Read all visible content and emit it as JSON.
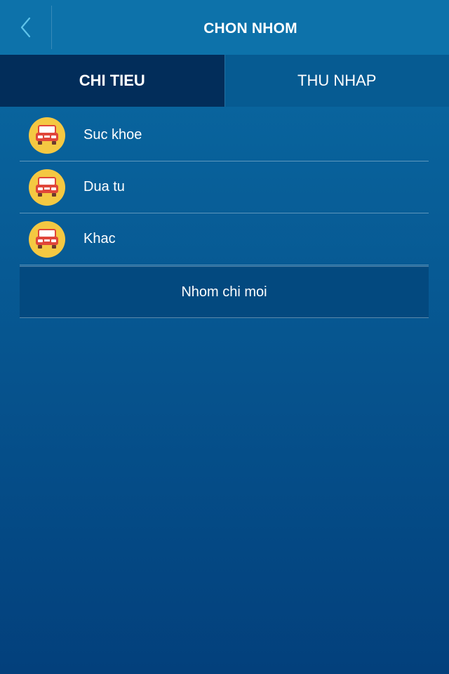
{
  "header": {
    "title": "CHON NHOM",
    "back_icon": "chevron-left-icon"
  },
  "tabs": [
    {
      "label": "CHI TIEU",
      "active": true
    },
    {
      "label": "THU NHAP",
      "active": false
    }
  ],
  "groups": [
    {
      "label": "Suc khoe",
      "icon": "car-icon"
    },
    {
      "label": "Dua tu",
      "icon": "car-icon"
    },
    {
      "label": "Khac",
      "icon": "car-icon"
    }
  ],
  "new_group_label": "Nhom chi moi",
  "colors": {
    "header_bg": "#0d72aa",
    "active_tab_bg": "#022d5a",
    "icon_bg": "#f4c842",
    "car_red": "#e0463a",
    "back_chevron": "#5fc3ea"
  }
}
